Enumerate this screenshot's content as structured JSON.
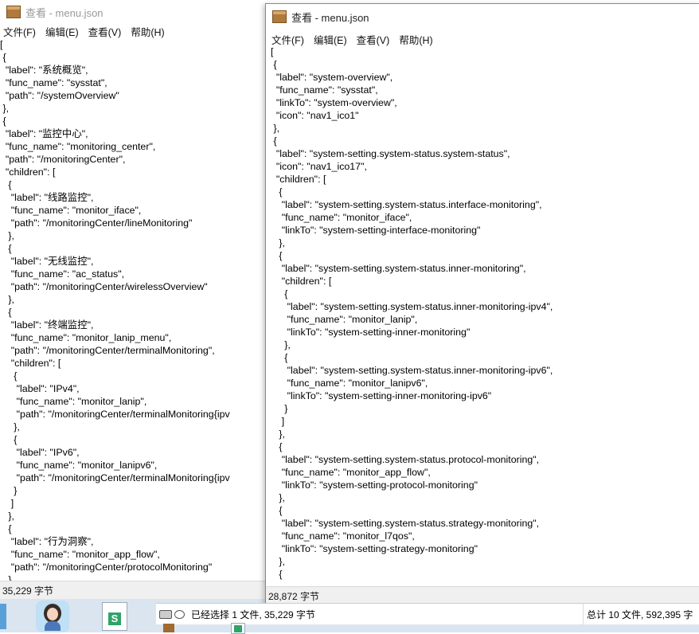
{
  "back_window": {
    "title": "查看 - menu.json",
    "menu": [
      "文件(F)",
      "编辑(E)",
      "查看(V)",
      "帮助(H)"
    ],
    "content": "[\n {\n  \"label\": \"系统概览\",\n  \"func_name\": \"sysstat\",\n  \"path\": \"/systemOverview\"\n },\n {\n  \"label\": \"监控中心\",\n  \"func_name\": \"monitoring_center\",\n  \"path\": \"/monitoringCenter\",\n  \"children\": [\n   {\n    \"label\": \"线路监控\",\n    \"func_name\": \"monitor_iface\",\n    \"path\": \"/monitoringCenter/lineMonitoring\"\n   },\n   {\n    \"label\": \"无线监控\",\n    \"func_name\": \"ac_status\",\n    \"path\": \"/monitoringCenter/wirelessOverview\"\n   },\n   {\n    \"label\": \"终端监控\",\n    \"func_name\": \"monitor_lanip_menu\",\n    \"path\": \"/monitoringCenter/terminalMonitoring\",\n    \"children\": [\n     {\n      \"label\": \"IPv4\",\n      \"func_name\": \"monitor_lanip\",\n      \"path\": \"/monitoringCenter/terminalMonitoring{ipv\n     },\n     {\n      \"label\": \"IPv6\",\n      \"func_name\": \"monitor_lanipv6\",\n      \"path\": \"/monitoringCenter/terminalMonitoring{ipv\n     }\n    ]\n   },\n   {\n    \"label\": \"行为洞察\",\n    \"func_name\": \"monitor_app_flow\",\n    \"path\": \"/monitoringCenter/protocolMonitoring\"\n   },",
    "status": "35,229 字节"
  },
  "front_window": {
    "title": "查看 - menu.json",
    "menu": [
      "文件(F)",
      "编辑(E)",
      "查看(V)",
      "帮助(H)"
    ],
    "content": "[\n {\n  \"label\": \"system-overview\",\n  \"func_name\": \"sysstat\",\n  \"linkTo\": \"system-overview\",\n  \"icon\": \"nav1_ico1\"\n },\n {\n  \"label\": \"system-setting.system-status.system-status\",\n  \"icon\": \"nav1_ico17\",\n  \"children\": [\n   {\n    \"label\": \"system-setting.system-status.interface-monitoring\",\n    \"func_name\": \"monitor_iface\",\n    \"linkTo\": \"system-setting-interface-monitoring\"\n   },\n   {\n    \"label\": \"system-setting.system-status.inner-monitoring\",\n    \"children\": [\n     {\n      \"label\": \"system-setting.system-status.inner-monitoring-ipv4\",\n      \"func_name\": \"monitor_lanip\",\n      \"linkTo\": \"system-setting-inner-monitoring\"\n     },\n     {\n      \"label\": \"system-setting.system-status.inner-monitoring-ipv6\",\n      \"func_name\": \"monitor_lanipv6\",\n      \"linkTo\": \"system-setting-inner-monitoring-ipv6\"\n     }\n    ]\n   },\n   {\n    \"label\": \"system-setting.system-status.protocol-monitoring\",\n    \"func_name\": \"monitor_app_flow\",\n    \"linkTo\": \"system-setting-protocol-monitoring\"\n   },\n   {\n    \"label\": \"system-setting.system-status.strategy-monitoring\",\n    \"func_name\": \"monitor_l7qos\",\n    \"linkTo\": \"system-setting-strategy-monitoring\"\n   },\n   {",
    "status": "28,872 字节"
  },
  "explorer_status": {
    "selection": "已经选择 1 文件, 35,229 字节",
    "total": "总计 10 文件, 592,395 字"
  },
  "taskbar": {
    "items": [
      "avatar-app",
      "spreadsheet-app",
      "file-icon",
      "spreadsheet-app-2"
    ]
  }
}
